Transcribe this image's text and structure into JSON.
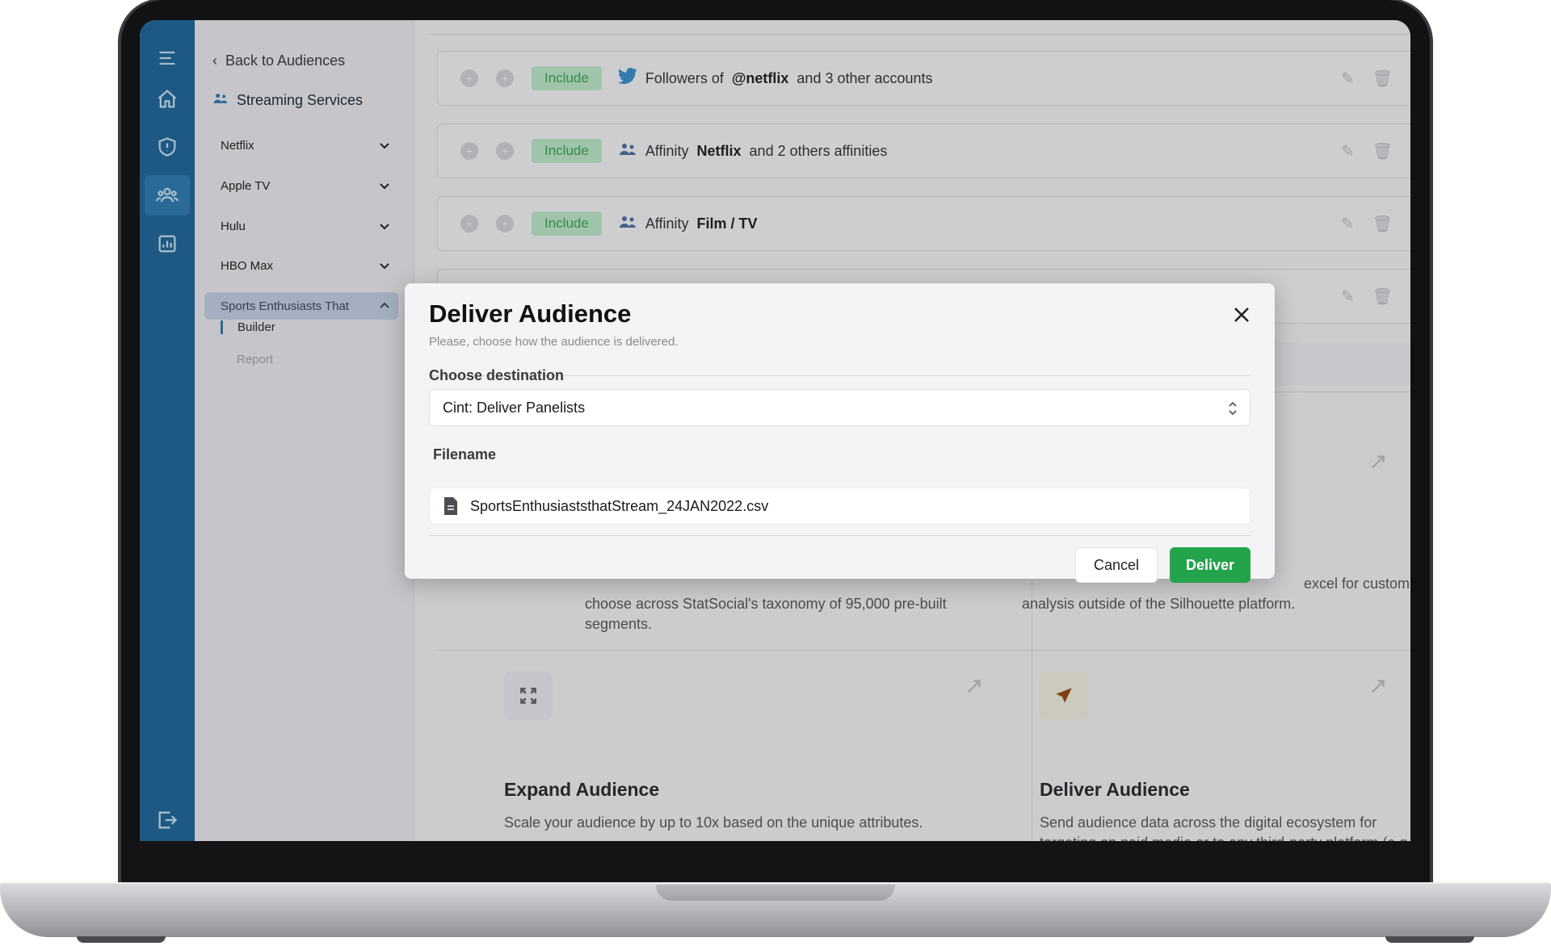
{
  "sidebar": {
    "back_label": "Back to Audiences",
    "group_title": "Streaming Services",
    "items": [
      {
        "label": "Netflix"
      },
      {
        "label": "Apple TV"
      },
      {
        "label": "Hulu"
      },
      {
        "label": "HBO Max"
      },
      {
        "label": "Sports Enthusiasts That"
      }
    ],
    "subitems": [
      {
        "label": "Builder"
      },
      {
        "label": "Report"
      }
    ]
  },
  "rules": [
    {
      "badge": "Include",
      "prefix": "Followers of",
      "bold": "@netflix",
      "suffix": "and 3 other accounts",
      "icon": "twitter-icon"
    },
    {
      "badge": "Include",
      "prefix": "Affinity",
      "bold": "Netflix",
      "suffix": "and 2 others affinities",
      "icon": "people-icon"
    },
    {
      "badge": "Include",
      "prefix": "Affinity",
      "bold": "Film / TV",
      "suffix": "",
      "icon": "people-icon"
    }
  ],
  "cards": {
    "segment_text": "choose across StatSocial's taxonomy of 95,000 pre-built segments.",
    "export_text_1": "excel for custom",
    "export_text_2": "analysis outside of the Silhouette platform.",
    "expand_title": "Expand Audience",
    "expand_text": "Scale your audience by up to 10x based on the unique attributes.",
    "deliver_title": "Deliver Audience",
    "deliver_text": "Send audience data across the digital ecosystem for targeting on paid media or to any third-party platform (e.g. CRM, DMP, DSP)."
  },
  "modal": {
    "title": "Deliver Audience",
    "subtitle": "Please, choose how the audience is delivered.",
    "destination_label": "Choose destination",
    "destination_value": "Cint: Deliver Panelists",
    "filename_label": "Filename",
    "filename_value": "SportsEnthusiaststhatStream_24JAN2022.csv",
    "cancel_label": "Cancel",
    "deliver_label": "Deliver"
  },
  "colors": {
    "rail": "#1f6493",
    "include_bg": "#b4ddbf",
    "include_text": "#3a9b57",
    "deliver_button": "#23a44a"
  }
}
